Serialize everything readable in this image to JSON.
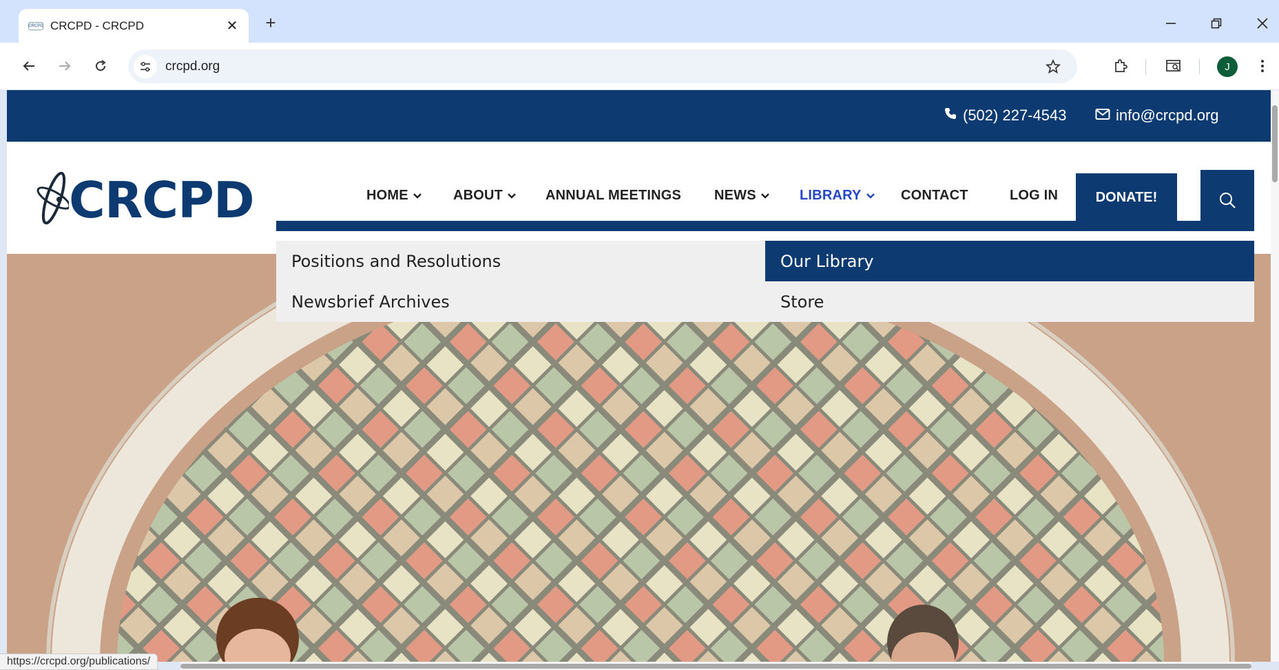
{
  "browser": {
    "tab_title": "CRCPD - CRCPD",
    "favicon_text": "CRCPD",
    "url": "crcpd.org",
    "profile_initial": "J",
    "status_url": "https://crcpd.org/publications/"
  },
  "topbar": {
    "phone": "(502) 227-4543",
    "email": "info@crcpd.org"
  },
  "logo": {
    "text": "CRCPD"
  },
  "nav": {
    "home": "HOME",
    "about": "ABOUT",
    "annual_meetings": "ANNUAL MEETINGS",
    "news": "NEWS",
    "library": "LIBRARY",
    "contact": "CONTACT",
    "login": "LOG IN",
    "donate": "DONATE!"
  },
  "dropdown": {
    "items": [
      {
        "label": "Positions and Resolutions"
      },
      {
        "label": "Our Library"
      },
      {
        "label": "Newsbrief Archives"
      },
      {
        "label": "Store"
      }
    ],
    "active_index": 1
  },
  "colors": {
    "brand_navy": "#0d3b71",
    "nav_active": "#2546c6",
    "hero_wall": "#c9a288"
  },
  "icons": [
    "phone-icon",
    "mail-icon",
    "search-icon",
    "chevron-down-icon",
    "back-icon",
    "forward-icon",
    "reload-icon",
    "star-icon",
    "extensions-icon",
    "tab-search-icon",
    "menu-icon"
  ]
}
